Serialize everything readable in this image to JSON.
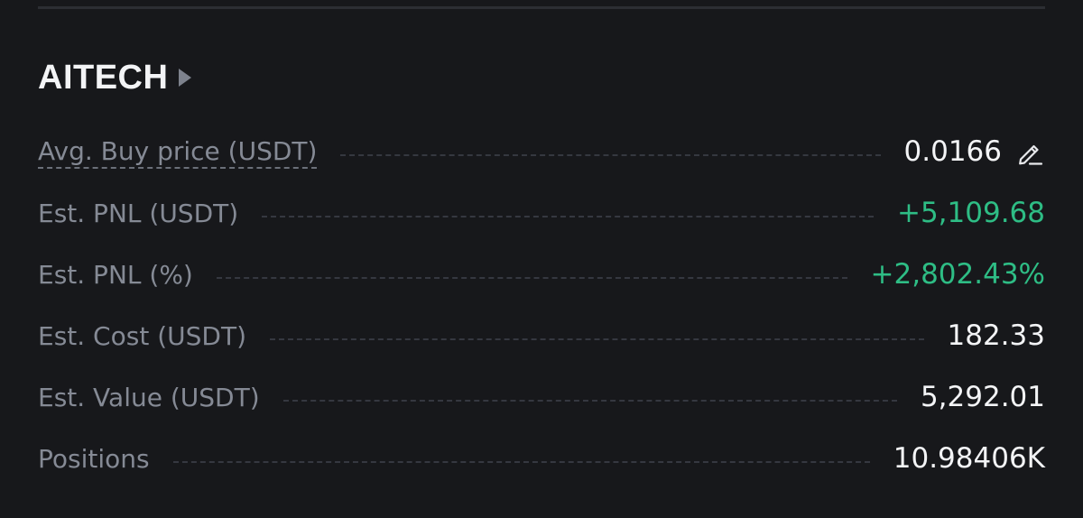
{
  "header": {
    "ticker": "AITECH"
  },
  "rows": [
    {
      "label": "Avg. Buy price (USDT)",
      "value": "0.0166",
      "has_edit": true
    },
    {
      "label": "Est. PNL (USDT)",
      "value": "+5,109.68"
    },
    {
      "label": "Est. PNL (%)",
      "value": "+2,802.43%"
    },
    {
      "label": "Est. Cost (USDT)",
      "value": "182.33"
    },
    {
      "label": "Est. Value (USDT)",
      "value": "5,292.01"
    },
    {
      "label": "Positions",
      "value": "10.98406K"
    }
  ],
  "colors": {
    "background": "#17181b",
    "label": "#858a95",
    "value": "#f3f4f6",
    "positive": "#2ebd85"
  },
  "icons": {
    "header_caret": "caret-right-icon",
    "edit": "pencil-icon"
  }
}
